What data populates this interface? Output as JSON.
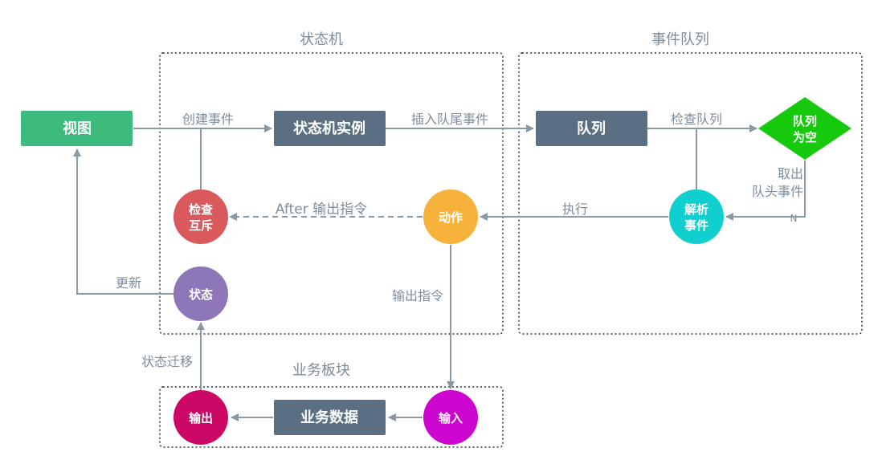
{
  "groups": {
    "state_machine": "状态机",
    "event_queue": "事件队列",
    "business": "业务板块"
  },
  "nodes": {
    "view": "视图",
    "sm_instance": "状态机实例",
    "queue": "队列",
    "queue_empty": [
      "队列",
      "为空"
    ],
    "check_mutex": [
      "检查",
      "互斥"
    ],
    "action": "动作",
    "parse_event": [
      "解析",
      "事件"
    ],
    "state": "状态",
    "output": "输出",
    "business_data": "业务数据",
    "input": "输入"
  },
  "edges": {
    "create_event": "创建事件",
    "insert_tail": "插入队尾事件",
    "check_queue": "检查队列",
    "take_head": [
      "取出",
      "队头事件"
    ],
    "no": "N",
    "execute": "执行",
    "after_output": "After 输出指令",
    "output_cmd": "输出指令",
    "update": "更新",
    "state_transition": "状态迁移"
  },
  "colors": {
    "view": "#3dba7e",
    "dark_box": "#5b6f82",
    "diamond": "#17c90c",
    "check_mutex": "#d9595c",
    "action": "#f7b23b",
    "parse_event": "#0fcfcf",
    "state": "#8d77b9",
    "output": "#cc0766",
    "input": "#cc06cf"
  }
}
